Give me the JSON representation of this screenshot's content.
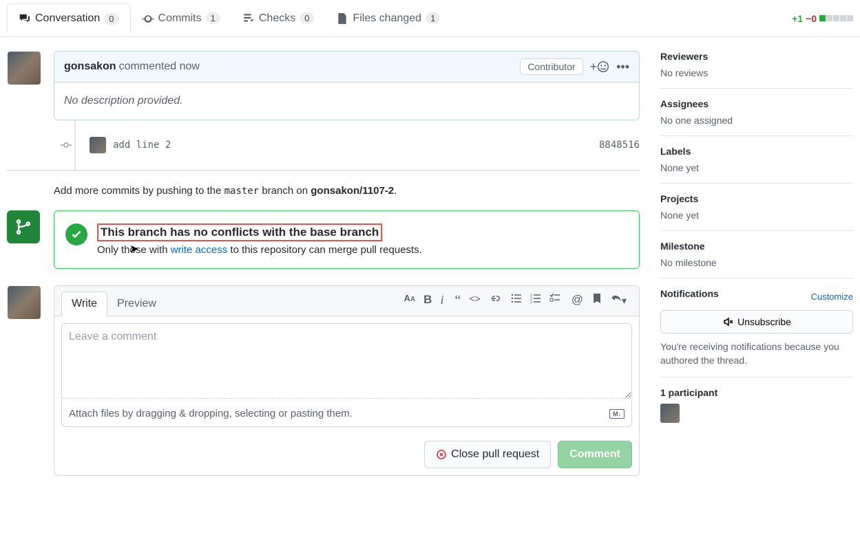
{
  "tabs": {
    "conversation": {
      "label": "Conversation",
      "count": "0"
    },
    "commits": {
      "label": "Commits",
      "count": "1"
    },
    "checks": {
      "label": "Checks",
      "count": "0"
    },
    "files": {
      "label": "Files changed",
      "count": "1"
    }
  },
  "diffstat": {
    "add": "+1",
    "del": "−0"
  },
  "comment": {
    "author": "gonsakon",
    "action": "commented now",
    "badge": "Contributor",
    "body": "No description provided."
  },
  "commit": {
    "message": "add line 2",
    "sha": "8848516"
  },
  "push_hint": {
    "prefix": "Add more commits by pushing to the ",
    "branch": "master",
    "mid": " branch on ",
    "repo": "gonsakon/1107-2",
    "suffix": "."
  },
  "merge": {
    "title": "This branch has no conflicts with the base branch",
    "sub_prefix": "Only those with ",
    "sub_link": "write access",
    "sub_suffix": " to this repository can merge pull requests."
  },
  "editor": {
    "tab_write": "Write",
    "tab_preview": "Preview",
    "placeholder": "Leave a comment",
    "attach": "Attach files by dragging & dropping, selecting or pasting them.",
    "close_btn": "Close pull request",
    "comment_btn": "Comment"
  },
  "sidebar": {
    "reviewers": {
      "title": "Reviewers",
      "value": "No reviews"
    },
    "assignees": {
      "title": "Assignees",
      "value": "No one assigned"
    },
    "labels": {
      "title": "Labels",
      "value": "None yet"
    },
    "projects": {
      "title": "Projects",
      "value": "None yet"
    },
    "milestone": {
      "title": "Milestone",
      "value": "No milestone"
    },
    "notifications": {
      "title": "Notifications",
      "customize": "Customize",
      "unsub": "Unsubscribe",
      "desc": "You're receiving notifications because you authored the thread."
    },
    "participants": {
      "title": "1 participant"
    }
  }
}
